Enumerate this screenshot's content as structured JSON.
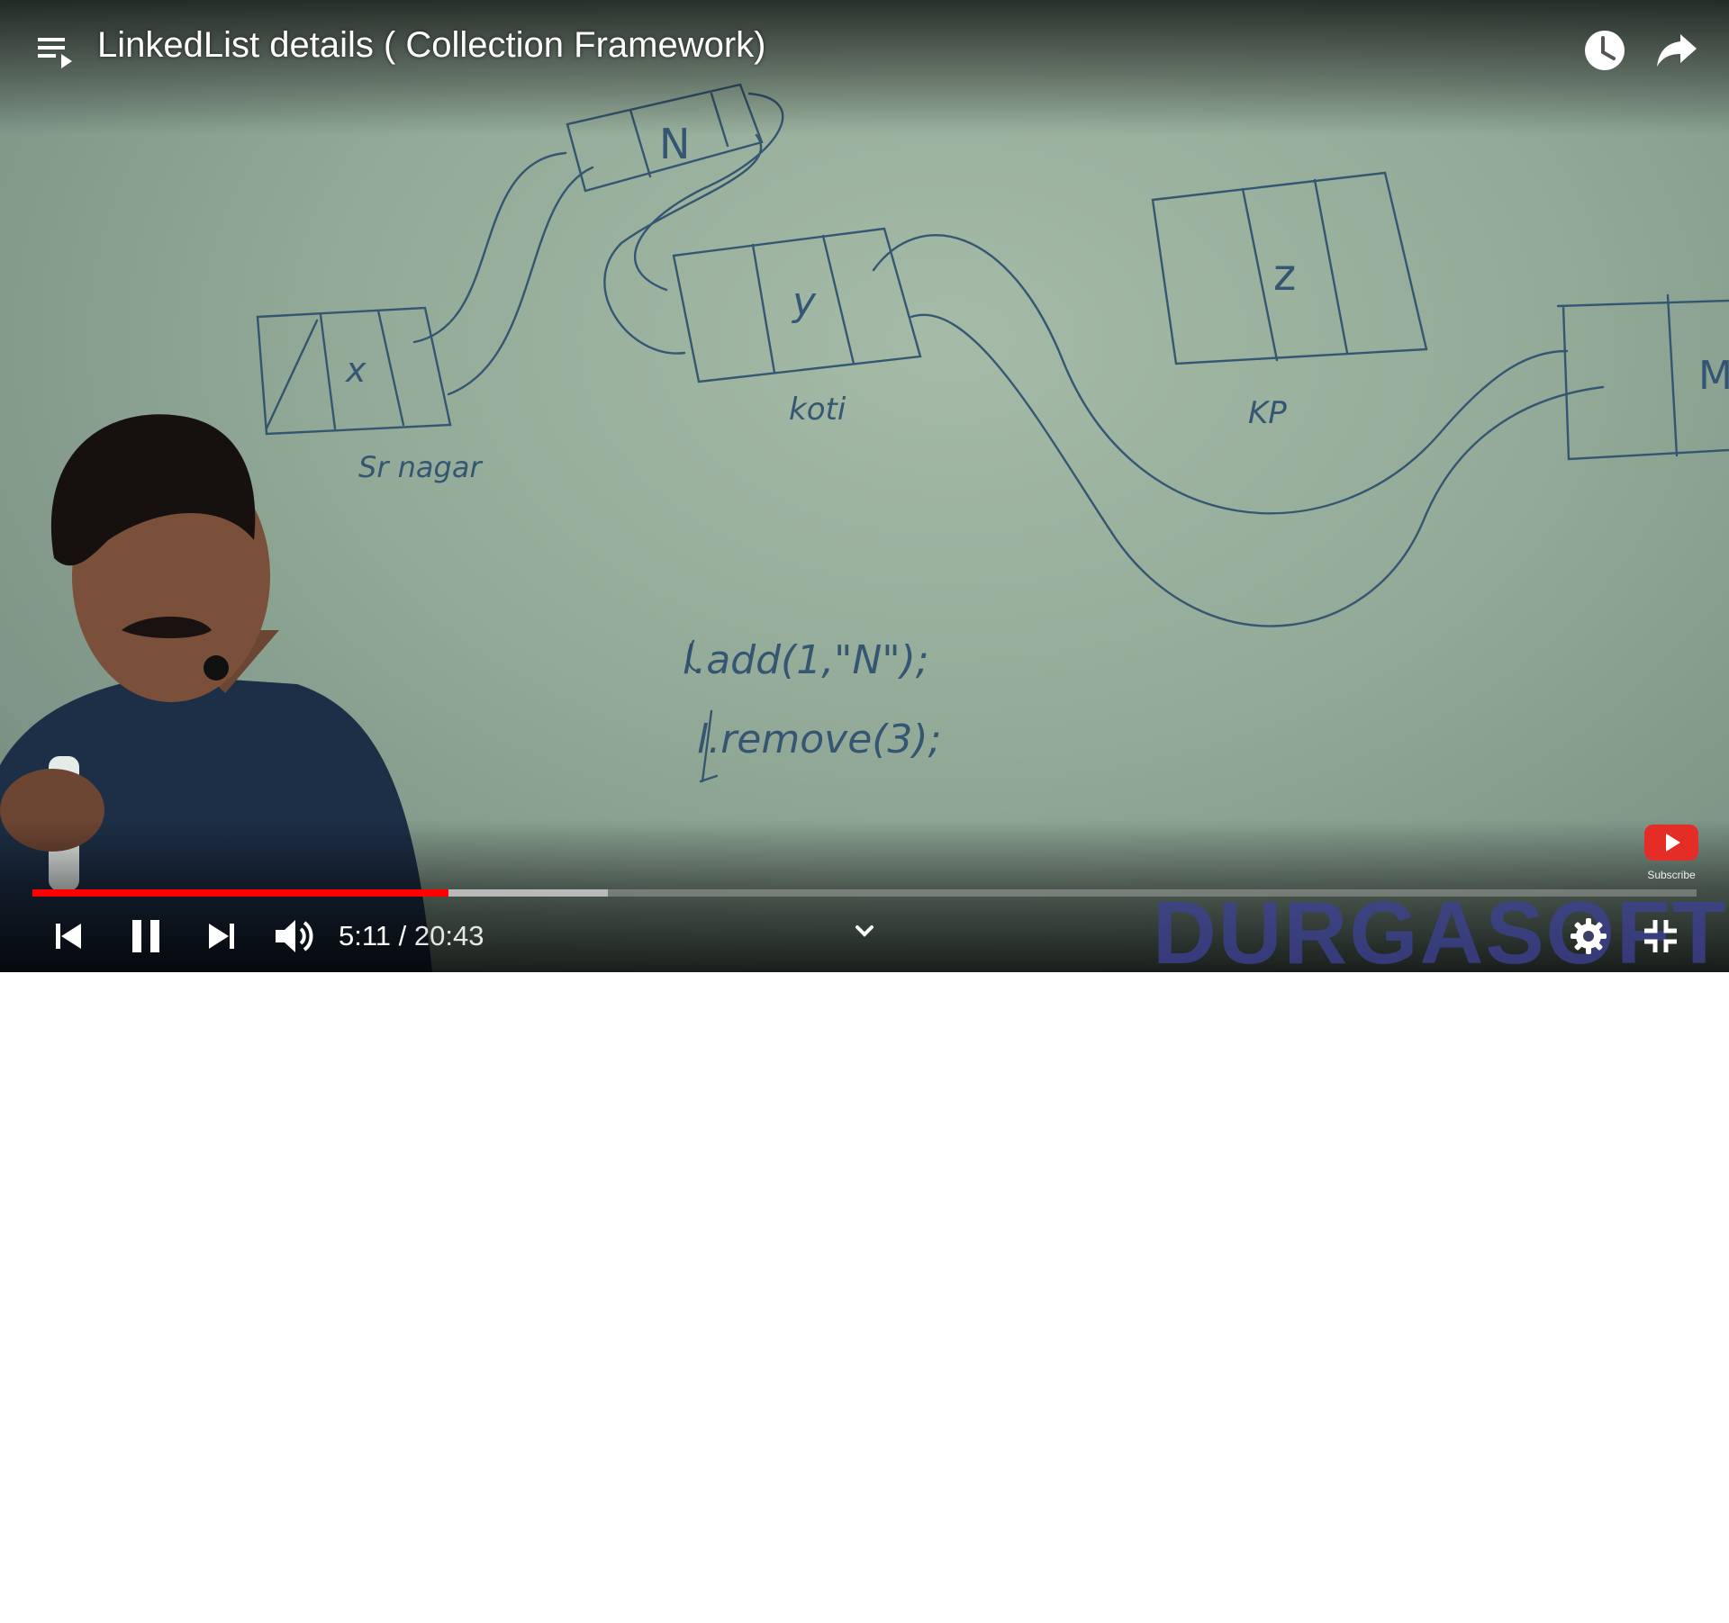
{
  "title": "LinkedList details ( Collection Framework)",
  "subscribe_label": "Subscribe",
  "time": {
    "current": "5:11",
    "separator": " / ",
    "duration": "20:43"
  },
  "progress": {
    "played_fraction": 0.25,
    "buffered_fraction": 0.346
  },
  "watermark": "DURGASOFT",
  "board": {
    "node_labels": [
      "x",
      "N",
      "y",
      "z",
      "M"
    ],
    "place_labels": [
      "Sr nagar",
      "koti",
      "KP"
    ],
    "code_lines": [
      "l.add(1,\"N\");",
      "l.remove(3);"
    ]
  },
  "colors": {
    "progress_played": "#ff0000",
    "board": "#9db3a1",
    "marker": "#1c3c64",
    "watermark": "#3e4296"
  },
  "icons": {
    "playlist": "playlist-icon",
    "watch_later": "clock-icon",
    "share": "share-arrow-icon",
    "previous": "skip-previous-icon",
    "pause": "pause-icon",
    "next": "skip-next-icon",
    "volume": "volume-icon",
    "chevron": "chevron-down-icon",
    "settings": "gear-icon",
    "exit_fullscreen": "exit-fullscreen-icon",
    "subscribe": "youtube-subscribe-icon"
  }
}
